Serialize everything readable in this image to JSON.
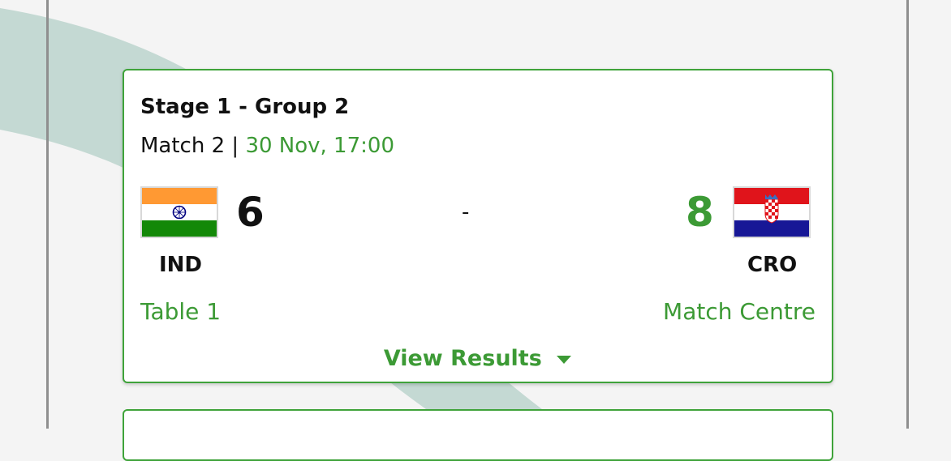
{
  "match": {
    "stage": "Stage 1 - Group 2",
    "match_label": "Match 2",
    "separator": "|",
    "datetime": "30 Nov, 17:00",
    "score_separator": "-",
    "home": {
      "code": "IND",
      "score": "6",
      "flag": "india-flag"
    },
    "away": {
      "code": "CRO",
      "score": "8",
      "flag": "croatia-flag"
    },
    "table_link": "Table 1",
    "match_centre_link": "Match Centre",
    "view_results": "View Results"
  },
  "colors": {
    "accent": "#3c9a35",
    "border": "#3fa33a",
    "background": "#f4f4f4",
    "swoosh": "#c4d9d3"
  }
}
